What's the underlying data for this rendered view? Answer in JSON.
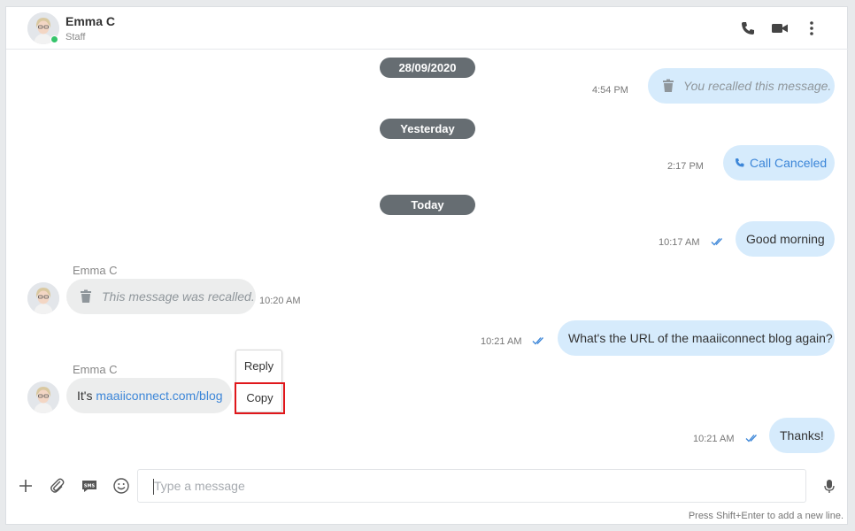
{
  "header": {
    "name": "Emma C",
    "role": "Staff",
    "status_color": "#35c46b",
    "icons": [
      "phone-icon",
      "video-icon",
      "more-vertical-icon"
    ]
  },
  "dates": [
    "28/09/2020",
    "Yesterday",
    "Today"
  ],
  "messages": [
    {
      "dir": "out",
      "kind": "recalled",
      "text": "You recalled this message.",
      "time": "4:54 PM"
    },
    {
      "dir": "out",
      "kind": "call",
      "text": "Call Canceled",
      "time": "2:17 PM"
    },
    {
      "dir": "out",
      "kind": "text",
      "text": "Good morning",
      "time": "10:17 AM",
      "read": true
    },
    {
      "dir": "in",
      "kind": "recalled",
      "sender": "Emma C",
      "text": "This message was recalled.",
      "time": "10:20 AM"
    },
    {
      "dir": "out",
      "kind": "text",
      "text": "What's the URL of the maaiiconnect blog again?",
      "time": "10:21 AM",
      "read": true
    },
    {
      "dir": "in",
      "kind": "link",
      "sender": "Emma C",
      "prefix": "It's ",
      "link": "maaiiconnect.com/blog"
    },
    {
      "dir": "out",
      "kind": "text",
      "text": "Thanks!",
      "time": "10:21 AM",
      "read": true
    }
  ],
  "context_menu": {
    "items": [
      "Reply",
      "Copy"
    ],
    "highlighted": "Copy",
    "highlight_color": "#e0171b"
  },
  "composer": {
    "placeholder": "Type a message",
    "icons": [
      "plus-icon",
      "paperclip-icon",
      "sms-icon",
      "emoji-icon",
      "microphone-icon"
    ],
    "hint": "Press Shift+Enter to add a new line."
  },
  "colors": {
    "outgoing_bubble": "#d6ebfc",
    "incoming_bubble": "#eceded",
    "date_pill": "#666d72",
    "link": "#3c86d8"
  }
}
